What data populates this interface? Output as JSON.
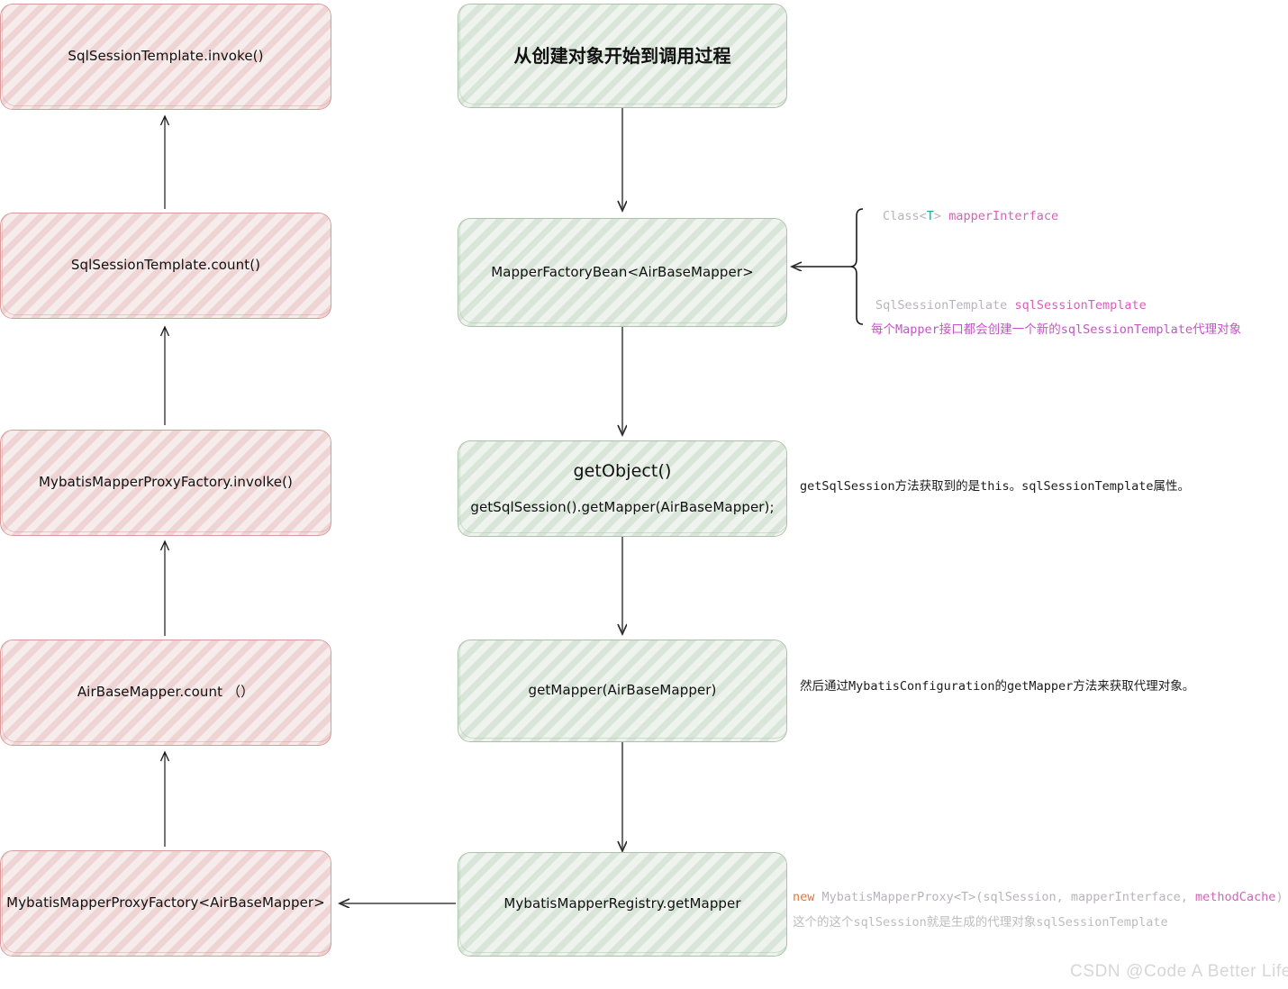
{
  "diagram": {
    "title_box": {
      "label": "从创建对象开始到调用过程"
    },
    "left_column": [
      {
        "id": "sqlsessiontemplate-invoke",
        "label": "SqlSessionTemplate.invoke()"
      },
      {
        "id": "sqlsessiontemplate-count",
        "label": "SqlSessionTemplate.count()"
      },
      {
        "id": "mybatismapperproxyfactory-involke",
        "label": "MybatisMapperProxyFactory.involke()"
      },
      {
        "id": "airbasemapper-count",
        "label": "AirBaseMapper.count （）"
      },
      {
        "id": "mybatismapperproxyfactory-generic",
        "label": "MybatisMapperProxyFactory<AirBaseMapper>"
      }
    ],
    "right_column": [
      {
        "id": "mapperfactorybean",
        "label": "MapperFactoryBean<AirBaseMapper>"
      },
      {
        "id": "getobject",
        "label": "getObject()",
        "sublabel": "getSqlSession().getMapper(AirBaseMapper);"
      },
      {
        "id": "getmapper",
        "label": "getMapper(AirBaseMapper)"
      },
      {
        "id": "mybatismapperregistry-getmapper",
        "label": "MybatisMapperRegistry.getMapper"
      }
    ],
    "annotations": {
      "brace_field_1": {
        "part_type": "Class<",
        "part_generic": "T",
        "part_close": "> ",
        "part_name": "mapperInterface"
      },
      "brace_field_2": {
        "part_type": "SqlSessionTemplate ",
        "part_name": "sqlSessionTemplate"
      },
      "brace_note": "每个Mapper接口都会创建一个新的sqlSessionTemplate代理对象",
      "getobject_note": "getSqlSession方法获取到的是this。sqlSessionTemplate属性。",
      "getmapper_note": "然后通过MybatisConfiguration的getMapper方法来获取代理对象。",
      "registry_code": {
        "kw_new": "new ",
        "body": "MybatisMapperProxy<T>(sqlSession, mapperInterface, ",
        "highlight": "methodCache",
        "tail": ")"
      },
      "registry_note": "这个的这个sqlSession就是生成的代理对象sqlSessionTemplate"
    },
    "watermark": "CSDN @Code A Better Life",
    "colors": {
      "pink_fill": "#f7ecec",
      "pink_stroke": "#d99a9a",
      "green_fill": "#eef3ee",
      "green_stroke": "#a8c3a8",
      "arrow_gray": "#6e6e6e",
      "arrow_black": "#1a1a1a",
      "accent_pink": "#d761b8",
      "accent_teal": "#1fa8a0",
      "accent_orange": "#e8733a",
      "accent_purple": "#c455c4"
    }
  }
}
